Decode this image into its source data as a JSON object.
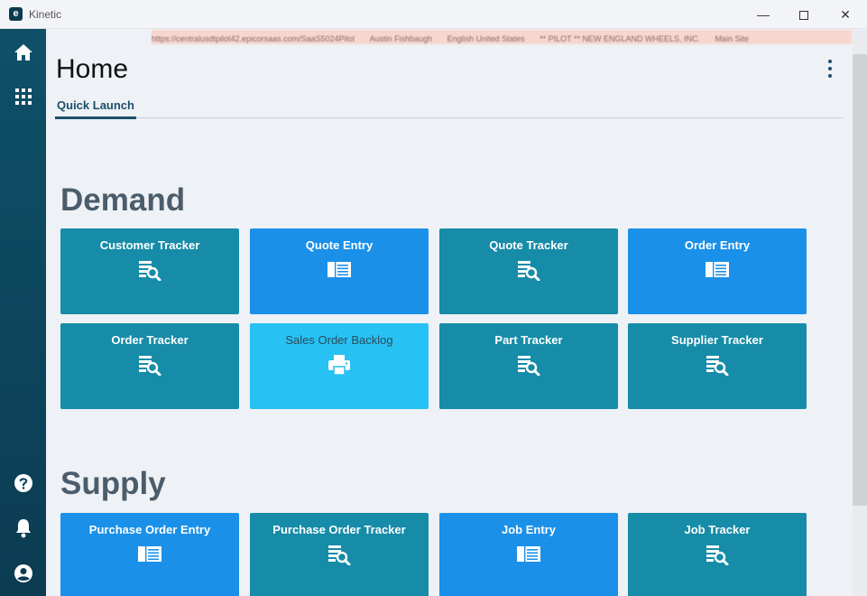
{
  "window": {
    "app_logo": "e",
    "title": "Kinetic",
    "minimize_glyph": "—",
    "close_glyph": "✕"
  },
  "infobar": {
    "items": [
      "https://centralusdtpilot42.epicorsaas.com/SaaS5024Pilot",
      "Austin Fishbaugh",
      "English United States",
      "** PILOT ** NEW ENGLAND WHEELS, INC.",
      "Main Site"
    ]
  },
  "sidebar": {
    "items": [
      {
        "name": "home",
        "icon": "home-icon"
      },
      {
        "name": "apps",
        "icon": "apps-grid-icon"
      },
      {
        "name": "help",
        "icon": "help-icon"
      },
      {
        "name": "notifications",
        "icon": "bell-icon"
      },
      {
        "name": "user",
        "icon": "user-icon"
      }
    ],
    "color_top": "#0f5068",
    "color_bottom": "#0b3c52"
  },
  "header": {
    "title": "Home",
    "tabs": [
      {
        "label": "Quick Launch",
        "active": true
      }
    ]
  },
  "colors": {
    "tracker_tile": "#168ca8",
    "entry_tile": "#1a90e8",
    "report_tile": "#28c1f3",
    "section_title": "#4b5c6b",
    "accent": "#1b4f6b"
  },
  "sections": [
    {
      "title": "Demand",
      "tiles": [
        {
          "label": "Customer Tracker",
          "icon": "tracker-search-icon"
        },
        {
          "label": "Quote Entry",
          "icon": "entry-form-icon"
        },
        {
          "label": "Quote Tracker",
          "icon": "tracker-search-icon"
        },
        {
          "label": "Order Entry",
          "icon": "entry-form-icon"
        },
        {
          "label": "Order Tracker",
          "icon": "tracker-search-icon"
        },
        {
          "label": "Sales Order Backlog",
          "icon": "printer-icon"
        },
        {
          "label": "Part Tracker",
          "icon": "tracker-search-icon"
        },
        {
          "label": "Supplier Tracker",
          "icon": "tracker-search-icon"
        }
      ]
    },
    {
      "title": "Supply",
      "tiles": [
        {
          "label": "Purchase Order Entry",
          "icon": "entry-form-icon"
        },
        {
          "label": "Purchase Order Tracker",
          "icon": "tracker-search-icon"
        },
        {
          "label": "Job Entry",
          "icon": "entry-form-icon"
        },
        {
          "label": "Job Tracker",
          "icon": "tracker-search-icon"
        }
      ]
    }
  ]
}
